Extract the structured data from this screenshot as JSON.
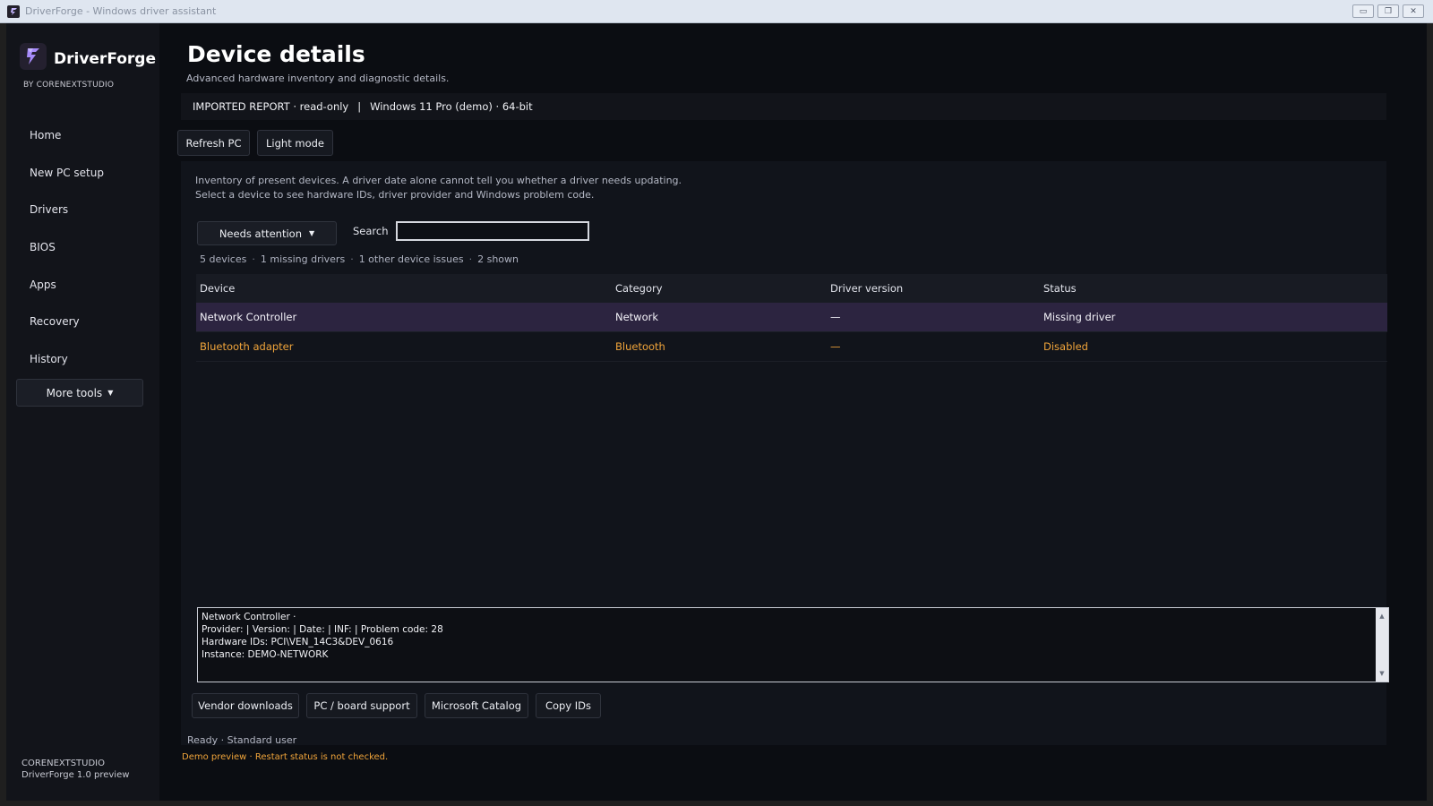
{
  "window": {
    "title": "DriverForge - Windows driver assistant",
    "controls": [
      "minimize",
      "restore",
      "close"
    ]
  },
  "sidebar": {
    "brand_name": "DriverForge",
    "brand_sub": "BY CORENEXTSTUDIO",
    "items": [
      {
        "label": "Home"
      },
      {
        "label": "New PC setup"
      },
      {
        "label": "Drivers"
      },
      {
        "label": "BIOS"
      },
      {
        "label": "Apps"
      },
      {
        "label": "Recovery"
      },
      {
        "label": "History"
      }
    ],
    "more_tools_label": "More tools",
    "footer_line1": "CORENEXTSTUDIO",
    "footer_line2": "DriverForge 1.0 preview"
  },
  "header": {
    "title": "Device details",
    "subtitle": "Advanced hardware inventory and diagnostic details.",
    "report_label": "IMPORTED REPORT · read-only",
    "separator": "|",
    "os_label": "Windows 11 Pro (demo) · 64-bit"
  },
  "toolbar": {
    "refresh_label": "Refresh PC",
    "light_mode_label": "Light mode"
  },
  "panel": {
    "intro_line1": "Inventory of present devices. A driver date alone cannot tell you whether a driver needs updating.",
    "intro_line2": "Select a device to see hardware IDs, driver provider and Windows problem code.",
    "filter_label": "Needs attention",
    "search_label": "Search",
    "search_value": "",
    "summary": {
      "devices": "5 devices",
      "missing": "1 missing drivers",
      "other": "1 other device issues",
      "shown": "2 shown"
    }
  },
  "table": {
    "columns": [
      "Device",
      "Category",
      "Driver version",
      "Status"
    ],
    "rows": [
      {
        "device": "Network Controller",
        "category": "Network",
        "version": "—",
        "status": "Missing driver",
        "selected": true
      },
      {
        "device": "Bluetooth adapter",
        "category": "Bluetooth",
        "version": "—",
        "status": "Disabled",
        "selected": false
      }
    ]
  },
  "details": {
    "line1": "Network Controller ·",
    "line2": "Provider:  | Version:  | Date:  | INF:  | Problem code: 28",
    "line3": "Hardware IDs: PCI\\VEN_14C3&DEV_0616",
    "line4": "Instance: DEMO-NETWORK"
  },
  "actions": {
    "vendor_label": "Vendor downloads",
    "board_label": "PC / board support",
    "catalog_label": "Microsoft Catalog",
    "copy_label": "Copy IDs"
  },
  "status": {
    "line": "Ready · Standard user",
    "demo_note": "Demo preview · Restart status is not checked."
  },
  "colors": {
    "accent": "#8b5cf6",
    "warning": "#f0a43a",
    "selected_row": "#2c2440",
    "background": "#0b0d12",
    "sidebar": "#12141a"
  }
}
